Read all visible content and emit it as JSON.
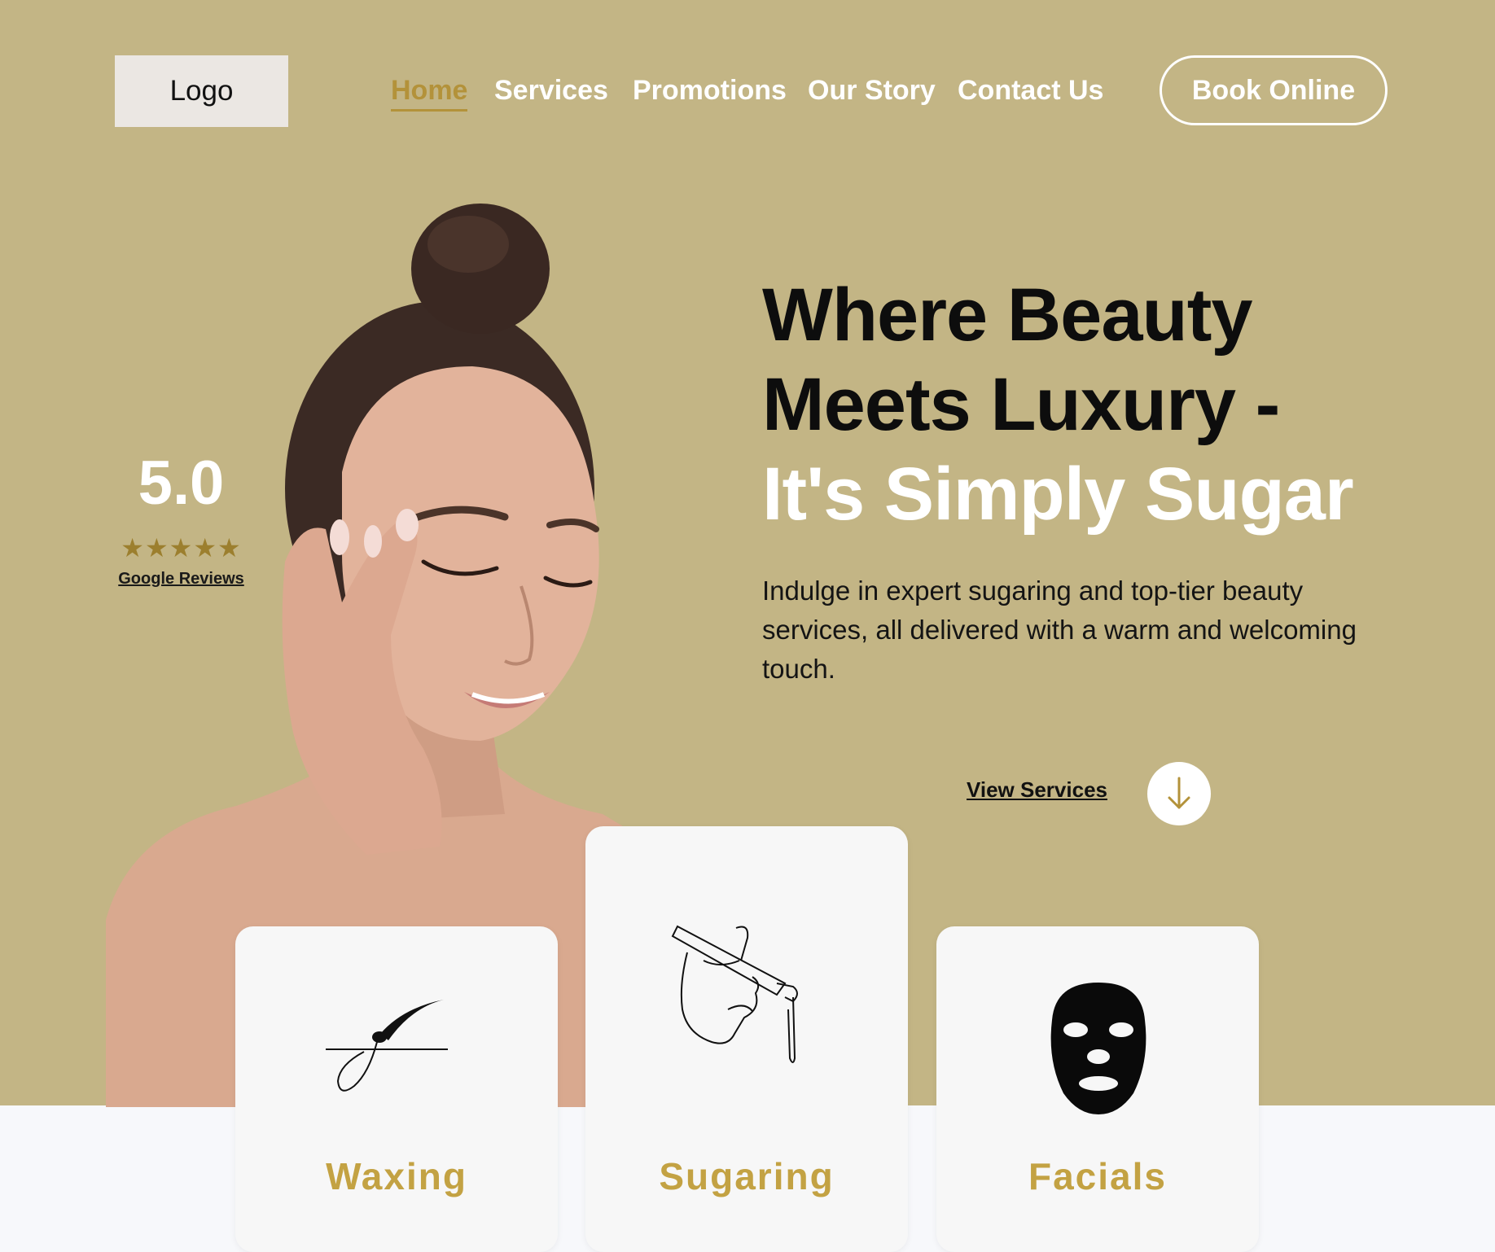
{
  "header": {
    "logo": "Logo",
    "nav": [
      {
        "label": "Home",
        "active": true
      },
      {
        "label": "Services"
      },
      {
        "label": "Promotions"
      },
      {
        "label": "Our Story"
      },
      {
        "label": "Contact Us"
      }
    ],
    "book_label": "Book Online"
  },
  "rating": {
    "value": "5.0",
    "stars": "★★★★★",
    "reviews_link": "Google Reviews"
  },
  "hero": {
    "headline_line1": "Where Beauty",
    "headline_line2": "Meets Luxury -",
    "headline_line3": "It's Simply Sugar",
    "subtext": "Indulge in expert sugaring and top-tier beauty services, all delivered with a warm and welcoming touch.",
    "cta_label": "View Services"
  },
  "cards": [
    {
      "title": "Waxing",
      "icon": "hair-follicle-icon"
    },
    {
      "title": "Sugaring",
      "icon": "sugaring-hand-icon"
    },
    {
      "title": "Facials",
      "icon": "face-mask-icon"
    }
  ],
  "colors": {
    "hero_bg": "#c3b585",
    "accent": "#b3923a",
    "card_title": "#c3a243",
    "page_bg": "#f7f8fb"
  }
}
